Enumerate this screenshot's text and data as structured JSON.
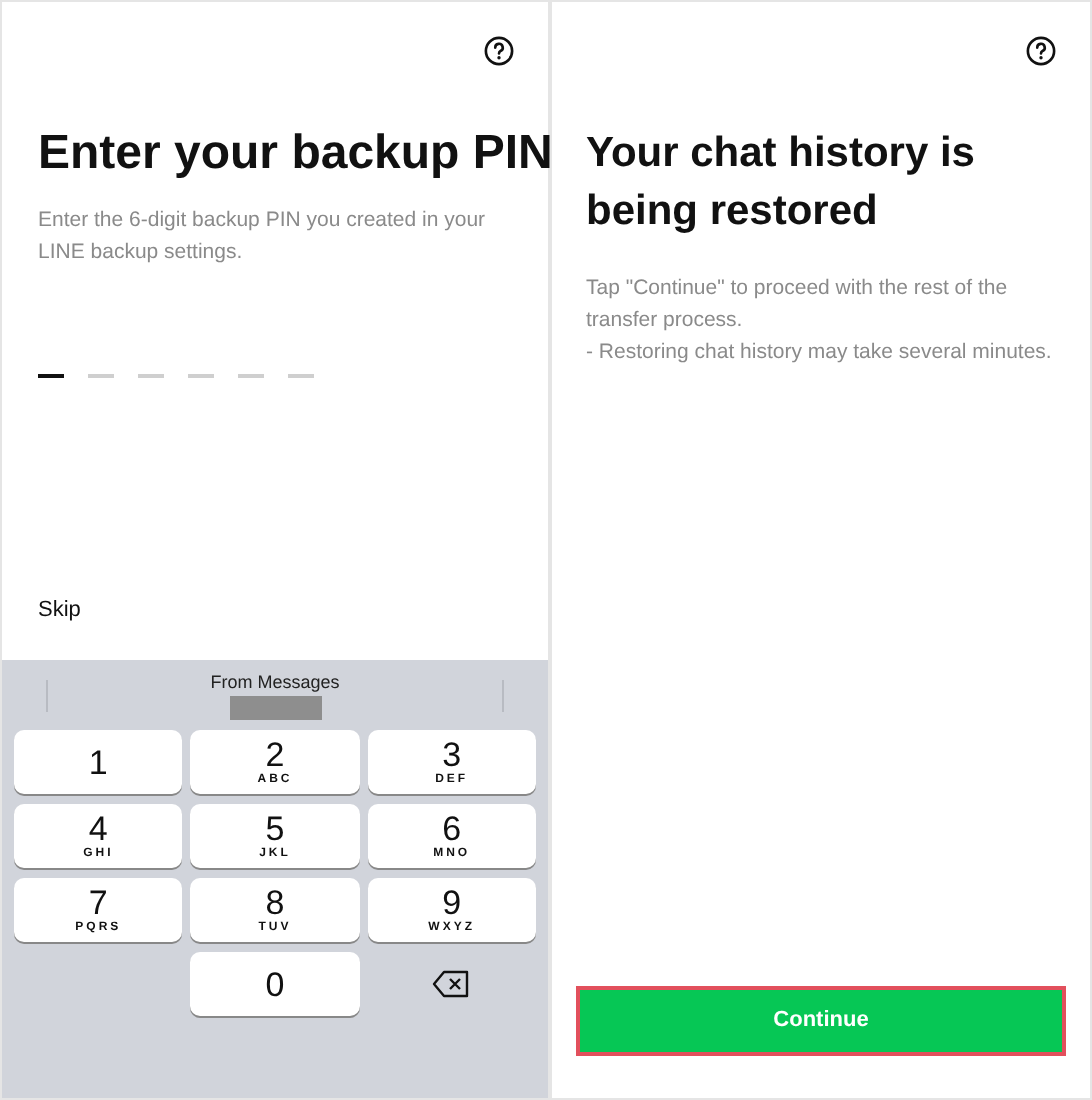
{
  "pin_screen": {
    "title": "Enter your backup PIN",
    "description": "Enter the 6-digit backup PIN you created in your LINE backup settings.",
    "pin_slots": [
      {
        "selected": true
      },
      {
        "selected": false
      },
      {
        "selected": false
      },
      {
        "selected": false
      },
      {
        "selected": false
      },
      {
        "selected": false
      }
    ],
    "skip": "Skip",
    "keyboard": {
      "suggestion": "From Messages",
      "keys": [
        {
          "kind": "digit",
          "digit": "1"
        },
        {
          "kind": "digit",
          "digit": "2",
          "letters": "ABC"
        },
        {
          "kind": "digit",
          "digit": "3",
          "letters": "DEF"
        },
        {
          "kind": "digit",
          "digit": "4",
          "letters": "GHI"
        },
        {
          "kind": "digit",
          "digit": "5",
          "letters": "JKL"
        },
        {
          "kind": "digit",
          "digit": "6",
          "letters": "MNO"
        },
        {
          "kind": "digit",
          "digit": "7",
          "letters": "PQRS"
        },
        {
          "kind": "digit",
          "digit": "8",
          "letters": "TUV"
        },
        {
          "kind": "digit",
          "digit": "9",
          "letters": "WXYZ"
        },
        {
          "kind": "blank"
        },
        {
          "kind": "digit",
          "digit": "0"
        },
        {
          "kind": "delete"
        }
      ]
    }
  },
  "restore_screen": {
    "title": "Your chat history is being restored",
    "description_lines": [
      "Tap \"Continue\" to proceed with the rest of the transfer process.",
      "- Restoring chat history may take several minutes."
    ],
    "button": "Continue",
    "button_highlighted": true
  }
}
